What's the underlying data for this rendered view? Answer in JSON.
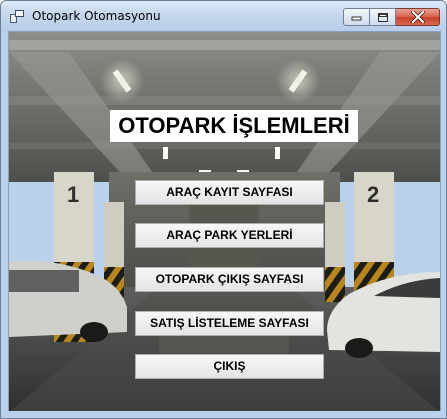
{
  "window": {
    "title": "Otopark Otomasyonu",
    "controls": {
      "minimize": "minimize",
      "maximize": "maximize",
      "close": "close"
    }
  },
  "main": {
    "heading": "OTOPARK İŞLEMLERİ",
    "pillar_numbers": [
      "1",
      "2"
    ],
    "buttons": [
      {
        "label": "ARAÇ KAYIT SAYFASI"
      },
      {
        "label": "ARAÇ PARK YERLERİ"
      },
      {
        "label": "OTOPARK ÇIKIŞ SAYFASI"
      },
      {
        "label": "SATIŞ LİSTELEME SAYFASI"
      },
      {
        "label": "ÇIKIŞ"
      }
    ]
  },
  "colors": {
    "titlebar": "#c6d8ee",
    "close_button": "#c7402a",
    "button_face": "#e4e4e4",
    "heading_bg": "#ffffff"
  },
  "icons": [
    "app-icon",
    "minimize-icon",
    "maximize-icon",
    "close-icon"
  ]
}
